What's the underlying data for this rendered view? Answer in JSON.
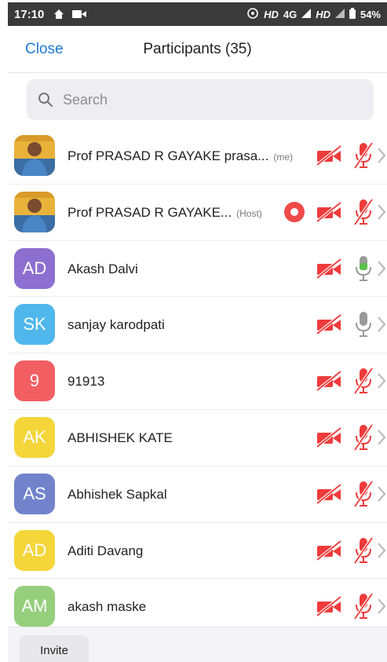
{
  "status_bar": {
    "time": "17:10",
    "hd1": "HD",
    "net": "4G",
    "hd2": "HD",
    "battery": "54%"
  },
  "header": {
    "close_label": "Close",
    "title": "Participants (35)"
  },
  "search": {
    "placeholder": "Search"
  },
  "participants": [
    {
      "name": "Prof PRASAD R GAYAKE prasa...",
      "tag": "(me)",
      "avatar": "photo",
      "initials": "",
      "color": "",
      "recording": false,
      "mic_state": "muted"
    },
    {
      "name": "Prof PRASAD R GAYAKE...",
      "tag": "(Host)",
      "avatar": "photo",
      "initials": "",
      "color": "",
      "recording": true,
      "mic_state": "muted"
    },
    {
      "name": "Akash Dalvi",
      "tag": "",
      "avatar": "initials",
      "initials": "AD",
      "color": "#8c6fd0",
      "recording": false,
      "mic_state": "speaking"
    },
    {
      "name": "sanjay karodpati",
      "tag": "",
      "avatar": "initials",
      "initials": "SK",
      "color": "#4fb7ec",
      "recording": false,
      "mic_state": "unmuted"
    },
    {
      "name": "91913",
      "tag": "",
      "avatar": "initials",
      "initials": "9",
      "color": "#f25f63",
      "recording": false,
      "mic_state": "muted"
    },
    {
      "name": "ABHISHEK KATE",
      "tag": "",
      "avatar": "initials",
      "initials": "AK",
      "color": "#f4d63a",
      "recording": false,
      "mic_state": "muted"
    },
    {
      "name": "Abhishek Sapkal",
      "tag": "",
      "avatar": "initials",
      "initials": "AS",
      "color": "#7283cc",
      "recording": false,
      "mic_state": "muted"
    },
    {
      "name": "Aditi Davang",
      "tag": "",
      "avatar": "initials",
      "initials": "AD",
      "color": "#f4d63a",
      "recording": false,
      "mic_state": "muted"
    },
    {
      "name": "akash maske",
      "tag": "",
      "avatar": "initials",
      "initials": "AM",
      "color": "#95cf7c",
      "recording": false,
      "mic_state": "muted"
    }
  ],
  "footer": {
    "invite_label": "Invite"
  },
  "colors": {
    "accent": "#1f7ad6",
    "muted_red": "#ef3b3b",
    "speaking_green": "#5cc04c",
    "mic_gray": "#9a9a9a"
  }
}
